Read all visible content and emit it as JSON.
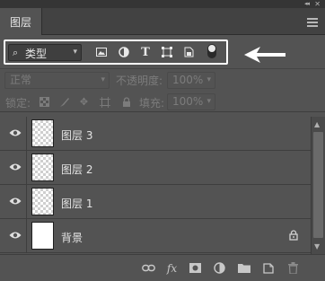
{
  "panel": {
    "tab_label": "图层"
  },
  "filter": {
    "kind_label": "类型",
    "icons": [
      "image-filter-icon",
      "adjustment-filter-icon",
      "type-filter-icon",
      "shape-filter-icon",
      "smart-object-filter-icon",
      "filter-toggle-icon"
    ]
  },
  "blend": {
    "mode": "正常",
    "opacity_label": "不透明度:",
    "opacity_value": "100%"
  },
  "lock": {
    "label": "锁定:",
    "fill_label": "填充:",
    "fill_value": "100%"
  },
  "layers": [
    {
      "name": "图层 3",
      "thumb": "transparent",
      "visible": true
    },
    {
      "name": "图层 2",
      "thumb": "transparent",
      "visible": true
    },
    {
      "name": "图层 1",
      "thumb": "transparent",
      "visible": true
    },
    {
      "name": "背景",
      "thumb": "white",
      "visible": true,
      "locked": true
    }
  ],
  "colors": {
    "panel_bg": "#535353",
    "highlight": "#ffffff"
  }
}
